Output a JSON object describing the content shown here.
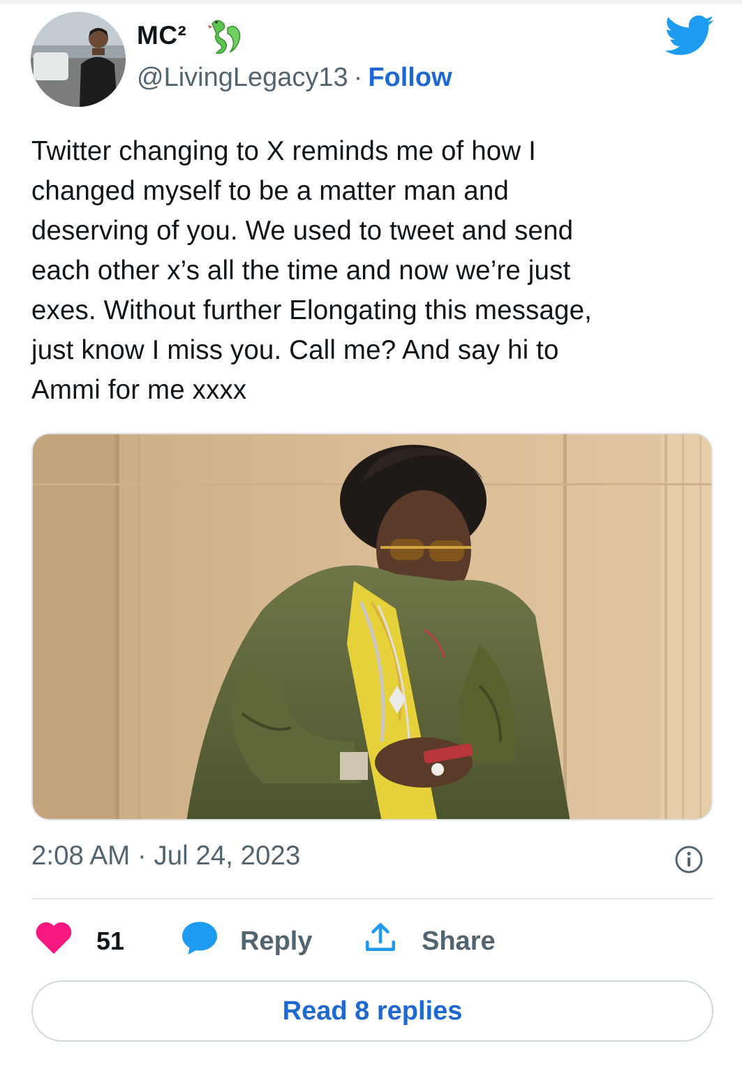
{
  "author": {
    "display_name": "MC²",
    "handle": "@LivingLegacy13",
    "separator": "·",
    "follow_label": "Follow",
    "verified_emoji_icon": "dragon-icon"
  },
  "tweet": {
    "text": "Twitter changing to X reminds me of how I\nchanged myself to be a matter man and\ndeserving of you. We used to tweet and send\neach other x’s all the time and now we’re just\nexes. Without further Elongating this message,\njust know I miss you. Call me? And say hi to\nAmmi for me xxxx",
    "timestamp": "2:08 AM · Jul 24, 2023"
  },
  "actions": {
    "like_count": "51",
    "reply_label": "Reply",
    "share_label": "Share",
    "read_replies_label": "Read 8 replies"
  },
  "colors": {
    "accent": "#1d68d1",
    "twitter_blue": "#1d9bf0",
    "like": "#f91880",
    "muted": "#536471"
  }
}
